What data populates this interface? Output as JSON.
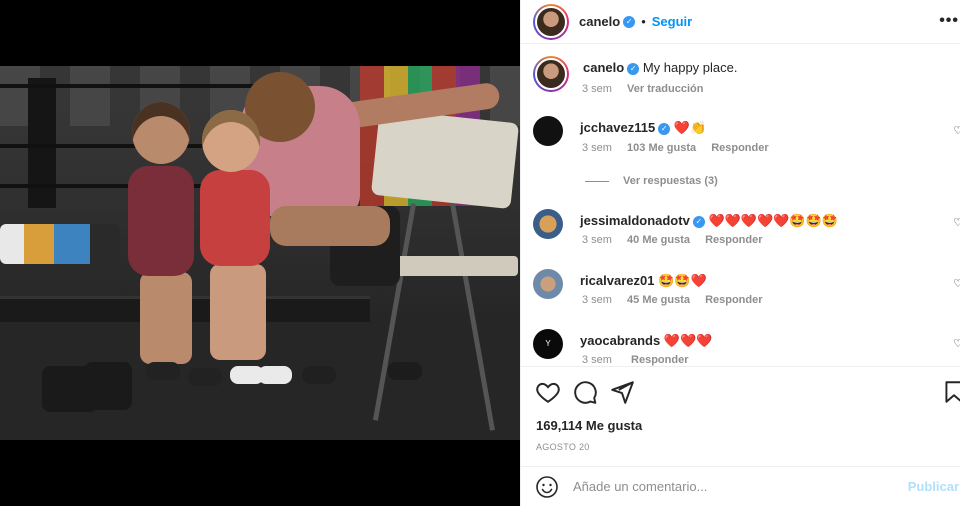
{
  "post": {
    "author": "canelo",
    "follow_label": "Seguir",
    "separator": "•",
    "more_label": "•••",
    "caption": "My happy place.",
    "caption_age": "3 sem",
    "translate_label": "Ver traducción"
  },
  "comments": [
    {
      "user": "jcchavez115",
      "verified": true,
      "text": "❤️👏",
      "age": "3 sem",
      "likes": "103 Me gusta",
      "reply_label": "Responder",
      "view_replies": "Ver respuestas (3)",
      "avatar_color": "#111111"
    },
    {
      "user": "jessimaldonadotv",
      "verified": true,
      "text": "❤️❤️❤️❤️❤️🤩🤩🤩",
      "age": "3 sem",
      "likes": "40 Me gusta",
      "reply_label": "Responder",
      "avatar_color": "#8a6a3c"
    },
    {
      "user": "ricalvarez01",
      "verified": false,
      "text": "🤩🤩❤️",
      "age": "3 sem",
      "likes": "45 Me gusta",
      "reply_label": "Responder",
      "avatar_color": "#5a6e8a"
    },
    {
      "user": "yaocabrands",
      "verified": false,
      "text": "❤️❤️❤️",
      "age": "3 sem",
      "likes": "",
      "reply_label": "Responder",
      "avatar_color": "#0a0a0a"
    }
  ],
  "actions": {
    "like_count": "169,114 Me gusta",
    "date": "AGOSTO 20"
  },
  "composer": {
    "placeholder": "Añade un comentario...",
    "post_label": "Publicar"
  },
  "colors": {
    "accent": "#0095f6",
    "verified": "#3897f0",
    "heart": "#ed1c24",
    "muted": "#8e8e8e"
  }
}
